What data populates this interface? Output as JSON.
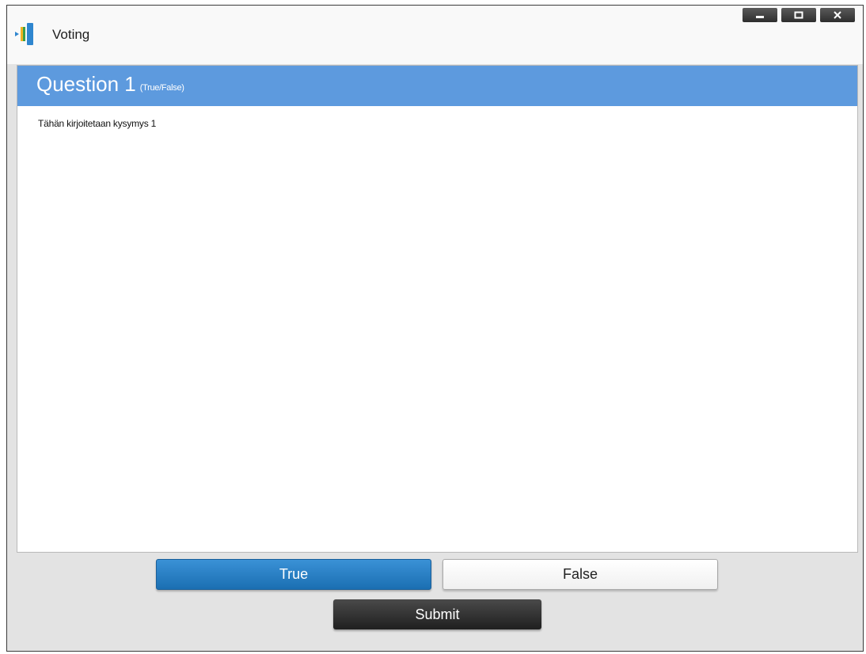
{
  "window": {
    "title": "Voting",
    "app_icon": "voting-app-icon",
    "controls": [
      {
        "name": "minimize",
        "icon": "minimize-icon"
      },
      {
        "name": "maximize",
        "icon": "maximize-icon"
      },
      {
        "name": "close",
        "icon": "close-icon"
      }
    ]
  },
  "question": {
    "title": "Question 1",
    "type": "(True/False)",
    "text": "Tähän kirjoitetaan kysymys 1"
  },
  "answers": {
    "true_label": "True",
    "false_label": "False",
    "selected": "True"
  },
  "submit_label": "Submit",
  "colors": {
    "header_blue": "#5d9ade",
    "true_button": "#1b6fb2",
    "submit_button": "#2a2a2a",
    "footer_bg": "#e3e3e3"
  }
}
